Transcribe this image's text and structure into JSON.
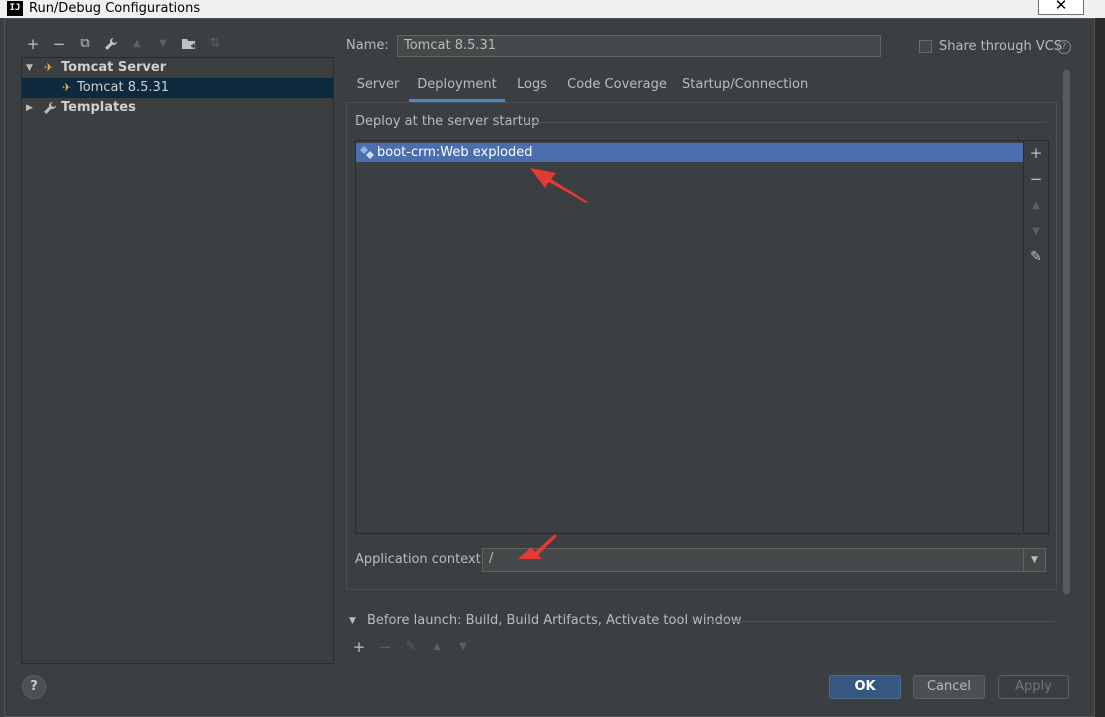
{
  "window": {
    "app_icon": "IJ",
    "title": "Run/Debug Configurations",
    "close_glyph": "✕"
  },
  "toolbar_left": {
    "add": "+",
    "remove": "−",
    "copy": "⧉",
    "edit_defaults": "🔧",
    "move_up": "▲",
    "move_down": "▼",
    "folder": "▰",
    "sort": "⇅"
  },
  "tree": {
    "group_label": "Tomcat Server",
    "child_label": "Tomcat 8.5.31",
    "templates_label": "Templates",
    "expanded_arrow": "▼",
    "collapsed_arrow": "▶"
  },
  "config": {
    "name_label": "Name:",
    "name_value": "Tomcat 8.5.31",
    "share_label": "Share through VCS",
    "share_checked": false,
    "help_glyph": "?"
  },
  "tabs": [
    {
      "label": "Server",
      "active": false
    },
    {
      "label": "Deployment",
      "active": true
    },
    {
      "label": "Logs",
      "active": false
    },
    {
      "label": "Code Coverage",
      "active": false
    },
    {
      "label": "Startup/Connection",
      "active": false
    }
  ],
  "deployment": {
    "section_label": "Deploy at the server startup",
    "items": [
      "boot-crm:Web exploded"
    ],
    "tools": {
      "add": "+",
      "remove": "−",
      "up": "▲",
      "down": "▼",
      "edit": "✎"
    },
    "context_label": "Application context:",
    "context_value": "/",
    "dropdown_glyph": "▼"
  },
  "before_launch": {
    "label": "Before launch: Build, Build Artifacts, Activate tool window",
    "arrow": "▼",
    "tools": {
      "add": "+",
      "remove": "−",
      "edit": "✎",
      "up": "▲",
      "down": "▼"
    }
  },
  "buttons": {
    "help": "?",
    "ok": "OK",
    "cancel": "Cancel",
    "apply": "Apply"
  },
  "colors": {
    "selection": "#4b6eaf",
    "tree_selection": "#0d293e",
    "ok_button": "#365880",
    "annotation_arrow": "#e53935"
  }
}
